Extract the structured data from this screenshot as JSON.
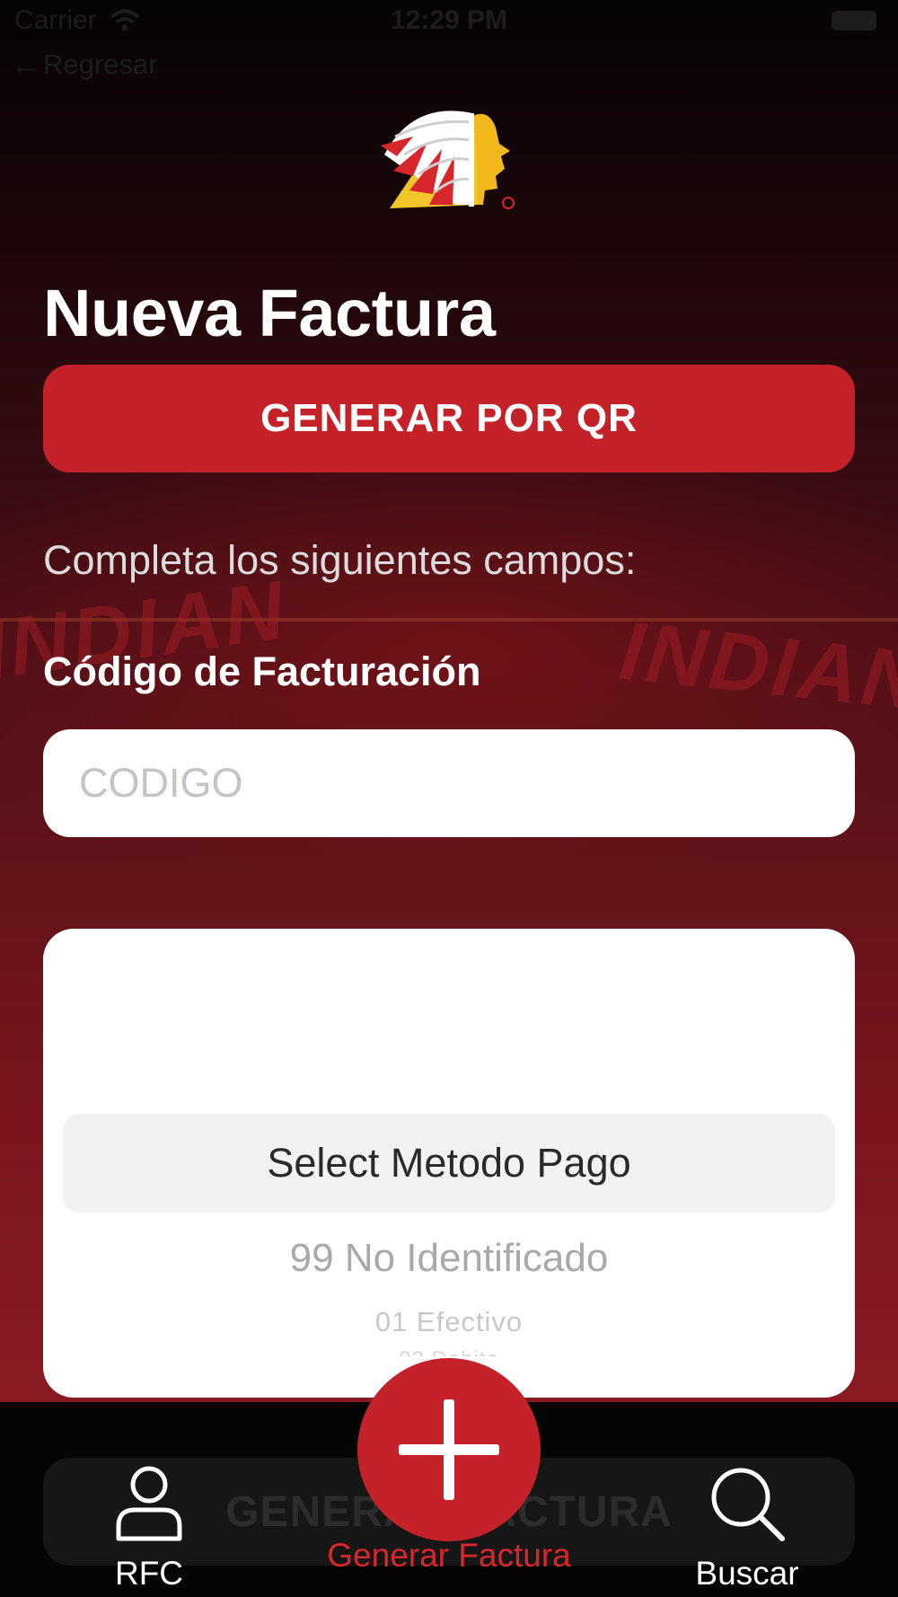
{
  "status_bar": {
    "carrier": "Carrier",
    "time": "12:29 PM"
  },
  "nav": {
    "back_label": "Regresar"
  },
  "header": {
    "title": "Nueva Factura"
  },
  "qr_button": {
    "label": "GENERAR POR QR"
  },
  "form": {
    "instructions": "Completa los siguientes campos:",
    "codigo_label": "Código de Facturación",
    "codigo_placeholder": "CODIGO",
    "codigo_value": ""
  },
  "payment_picker": {
    "selected": "Select Metodo Pago",
    "options": [
      "99 No Identificado",
      "01 Efectivo",
      "02 Debito"
    ]
  },
  "background_sign": {
    "text": "INDIAN"
  },
  "tab_bar": {
    "ghost_button_label": "GENERAR FACTURA",
    "tabs": [
      {
        "label": "RFC",
        "icon": "person-icon"
      },
      {
        "label": "Generar Factura",
        "icon": "plus-icon",
        "active": true
      },
      {
        "label": "Buscar",
        "icon": "search-icon"
      }
    ]
  },
  "colors": {
    "accent": "#c52128",
    "active_tab": "#d8262d"
  }
}
